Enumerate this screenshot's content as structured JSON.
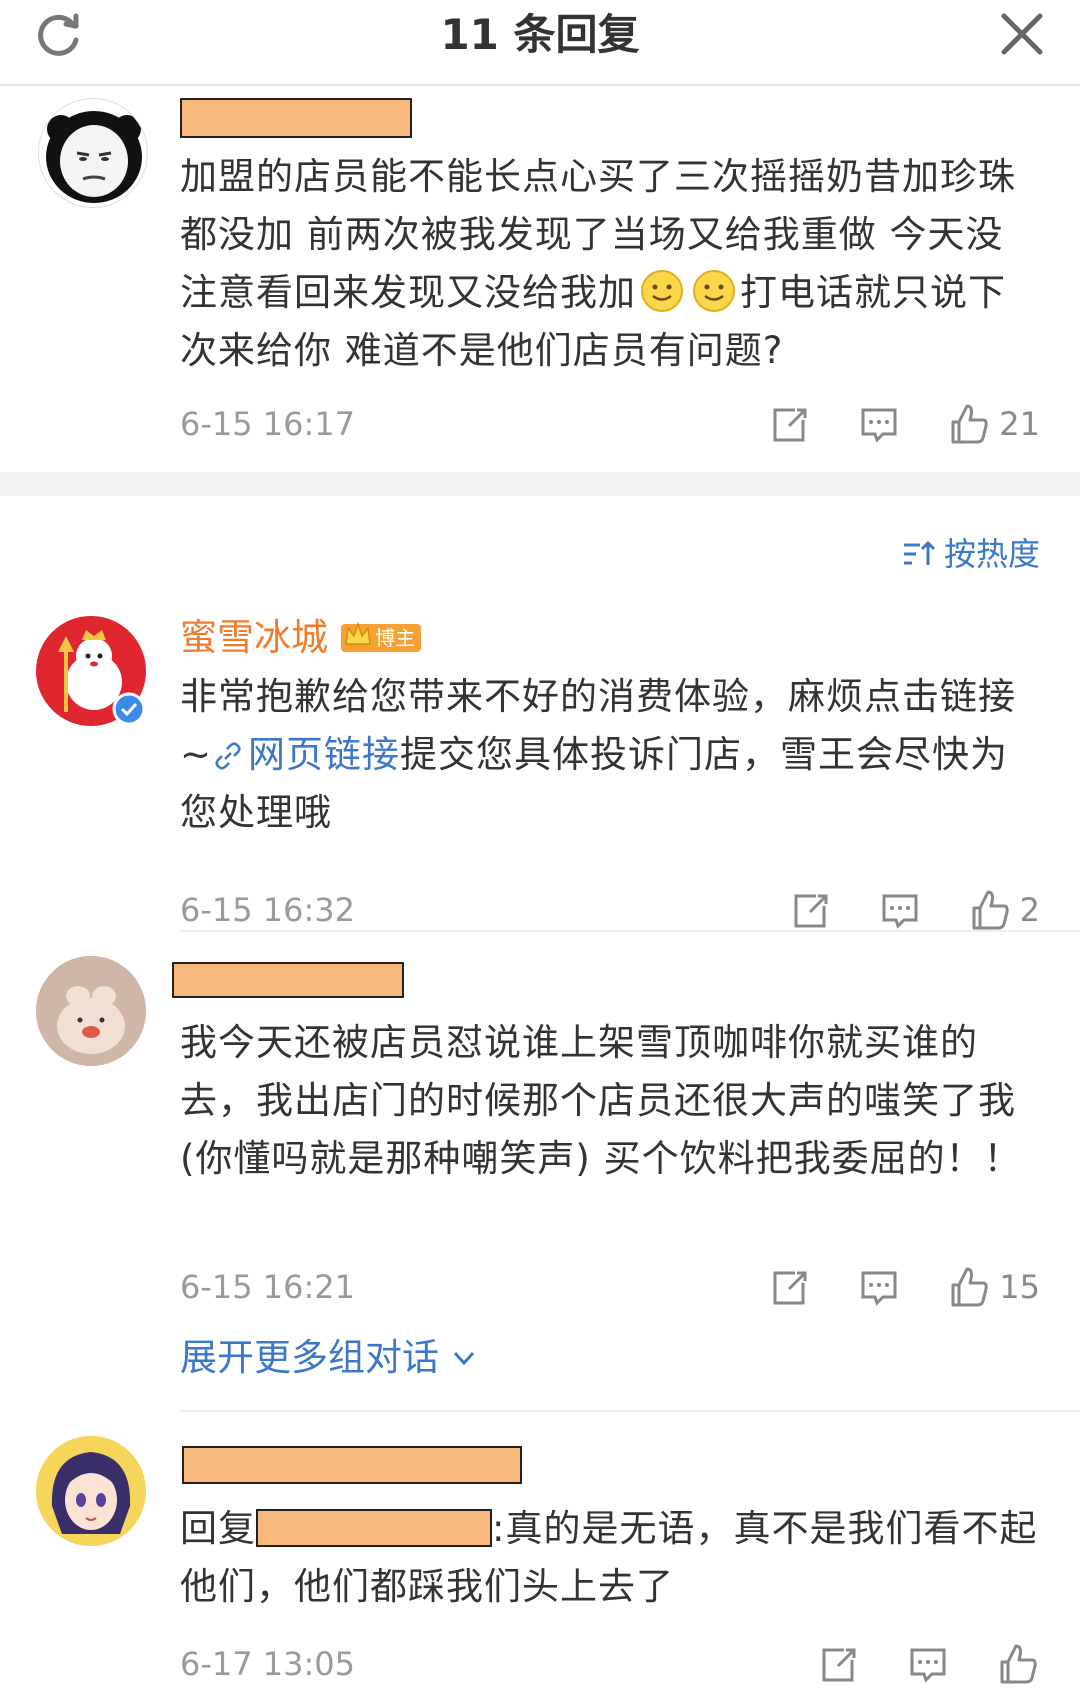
{
  "header": {
    "title": "11 条回复"
  },
  "comments": [
    {
      "text": "加盟的店员能不能长点心买了三次摇摇奶昔加珍珠都没加 前两次被我发现了当场又给我重做 今天没注意看回来发现又没给我加",
      "text_after_emoji": "打电话就只说下次来给你 难道不是他们店员有问题?",
      "time": "6-15 16:17",
      "likes": "21"
    },
    {
      "name": "蜜雪冰城",
      "badge": "博主",
      "text_before_link": "非常抱歉给您带来不好的消费体验，麻烦点击链接~",
      "link": "网页链接",
      "text_after_link": "提交您具体投诉门店，雪王会尽快为您处理哦",
      "time": "6-15 16:32",
      "likes": "2"
    },
    {
      "text": "我今天还被店员怼说谁上架雪顶咖啡你就买谁的去，我出店门的时候那个店员还很大声的嗤笑了我 (你懂吗就是那种嘲笑声) 买个饮料把我委屈的！！",
      "time": "6-15 16:21",
      "likes": "15"
    },
    {
      "reply_prefix": "回复",
      "text": ":真的是无语，真不是我们看不起他们，他们都踩我们头上去了",
      "time": "6-17 13:05",
      "likes": ""
    }
  ],
  "sort_label": "按热度",
  "expand_label": "展开更多组对话",
  "colors": {
    "accent_blue": "#3c78c8",
    "name_orange": "#ef7b2c",
    "redaction": "#f6b97b"
  },
  "icons": [
    "refresh-icon",
    "close-icon",
    "share-icon",
    "comment-icon",
    "like-icon",
    "sort-icon",
    "chevron-down-icon",
    "link-icon",
    "verified-icon",
    "smile-emoji"
  ]
}
